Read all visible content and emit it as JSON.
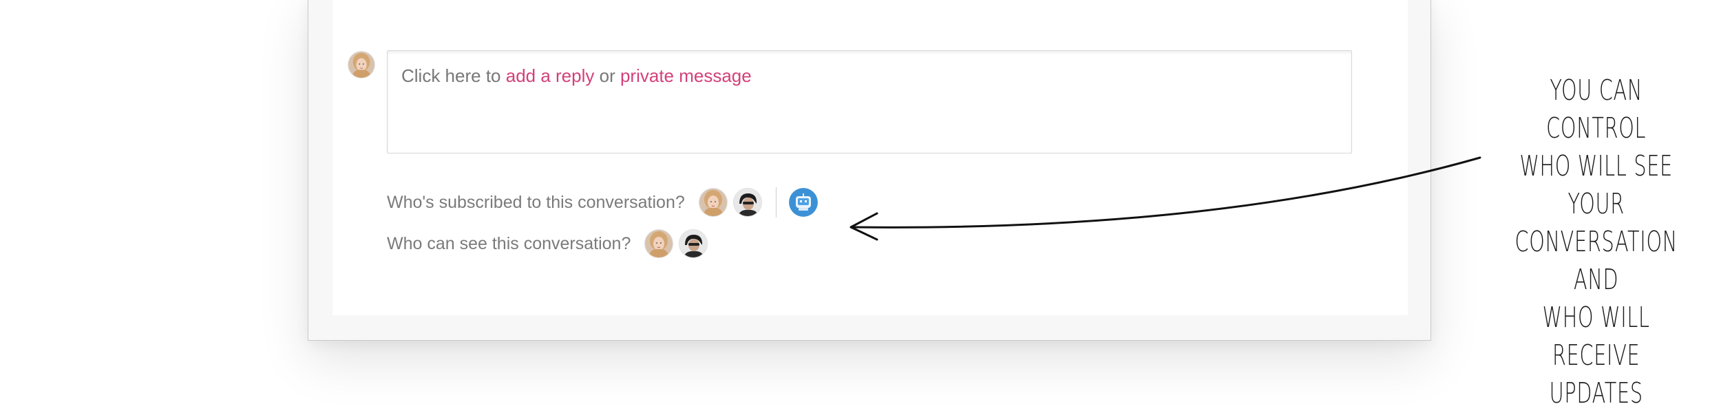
{
  "composer": {
    "prefix": "Click here to ",
    "reply_link": "add a reply",
    "connector": " or ",
    "private_link": "private message"
  },
  "subscribers": {
    "label": "Who's subscribed to this conversation?",
    "avatars": [
      "user-blonde-avatar",
      "user-dark-hair-avatar"
    ],
    "bot": "bot-avatar"
  },
  "visibility": {
    "label": "Who can see this conversation?",
    "avatars": [
      "user-blonde-avatar",
      "user-dark-hair-avatar"
    ]
  },
  "annotation": {
    "lines": [
      "YOU CAN CONTROL",
      "WHO WILL SEE YOUR",
      "CONVERSATION AND",
      "WHO WILL RECEIVE",
      "UPDATES"
    ]
  },
  "colors": {
    "link": "#d3407a",
    "muted_text": "#777777",
    "bot_blue": "#3c91d6"
  }
}
